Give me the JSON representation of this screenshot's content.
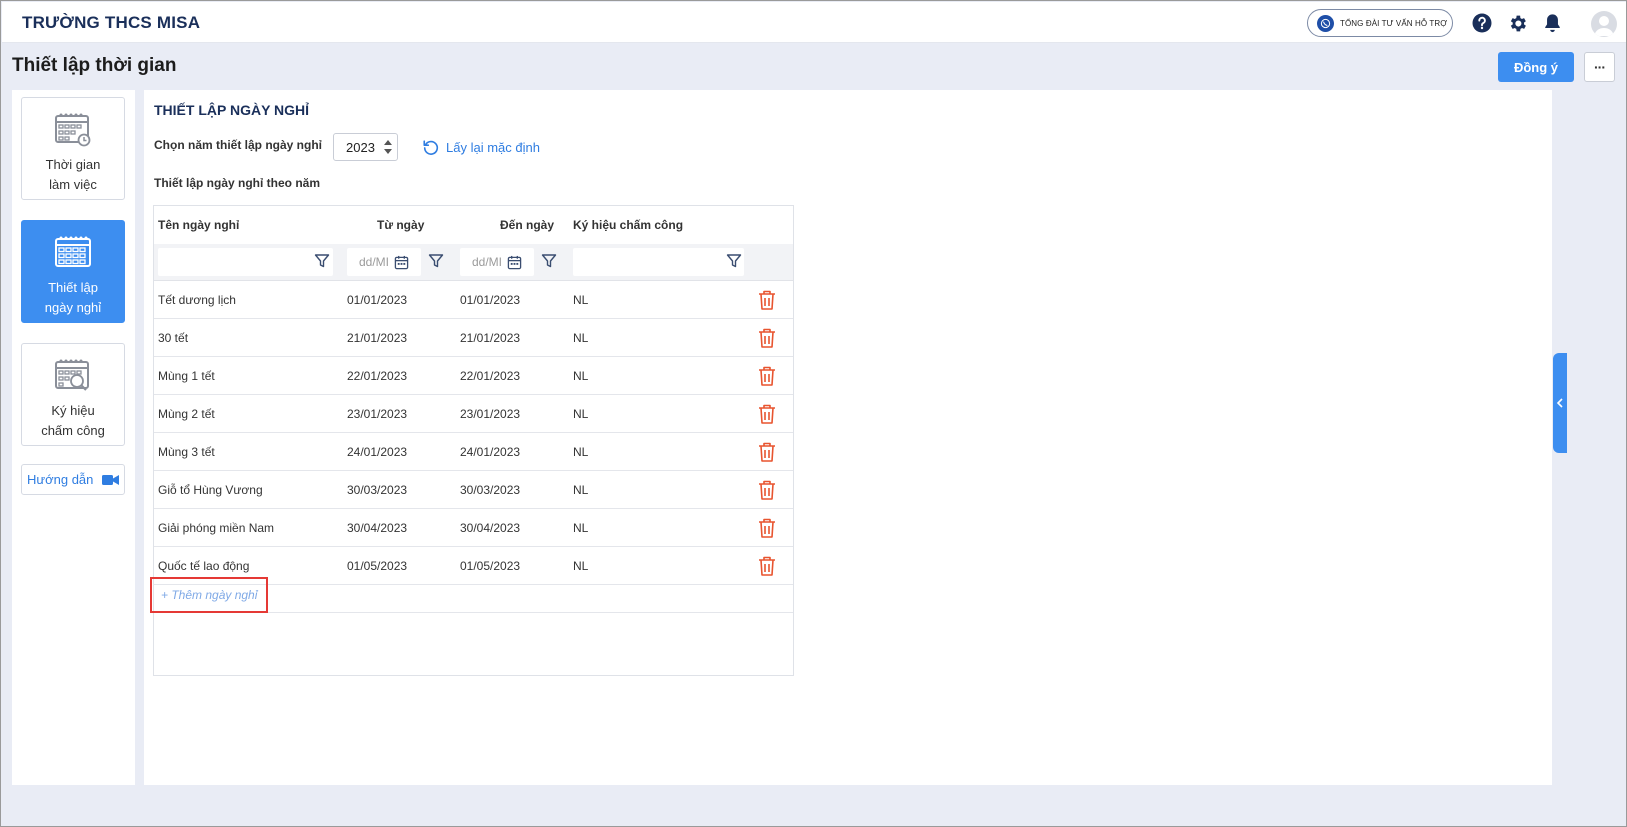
{
  "app": {
    "title": "TRƯỜNG THCS MISA"
  },
  "header": {
    "hotline_label": "TỔNG ĐÀI TƯ VẤN HỖ TRỢ",
    "icons": [
      "help-icon",
      "settings-icon",
      "bell-icon",
      "avatar"
    ]
  },
  "page": {
    "title": "Thiết lập thời gian",
    "agree_label": "Đồng ý",
    "more_label": "···"
  },
  "nav": {
    "items": [
      {
        "line1": "Thời gian",
        "line2": "làm việc",
        "active": false
      },
      {
        "line1": "Thiết lập",
        "line2": "ngày nghỉ",
        "active": true
      },
      {
        "line1": "Ký hiệu",
        "line2": "chấm công",
        "active": false
      }
    ],
    "guide_label": "Hướng dẫn"
  },
  "main": {
    "section_title": "THIẾT LẬP NGÀY NGHỈ",
    "year_label": "Chọn năm thiết lập ngày nghỉ",
    "year_value": "2023",
    "reset_label": "Lấy lại mặc định",
    "sub_title": "Thiết lập ngày nghỉ theo năm",
    "table": {
      "columns": [
        "Tên ngày nghỉ",
        "Từ ngày",
        "Đến ngày",
        "Ký hiệu chấm công"
      ],
      "date_placeholder": "dd/MI",
      "rows": [
        [
          "Tết dương lịch",
          "01/01/2023",
          "01/01/2023",
          "NL"
        ],
        [
          "30 tết",
          "21/01/2023",
          "21/01/2023",
          "NL"
        ],
        [
          "Mùng 1 tết",
          "22/01/2023",
          "22/01/2023",
          "NL"
        ],
        [
          "Mùng 2 tết",
          "23/01/2023",
          "23/01/2023",
          "NL"
        ],
        [
          "Mùng 3 tết",
          "24/01/2023",
          "24/01/2023",
          "NL"
        ],
        [
          "Giỗ tổ Hùng Vương",
          "30/03/2023",
          "30/03/2023",
          "NL"
        ],
        [
          "Giải phóng miền Nam",
          "30/04/2023",
          "30/04/2023",
          "NL"
        ],
        [
          "Quốc tế lao động",
          "01/05/2023",
          "01/05/2023",
          "NL"
        ]
      ],
      "add_label": "+ Thêm ngày nghỉ"
    }
  },
  "colors": {
    "primary": "#3d8ef0",
    "title_navy": "#1a2f5a",
    "delete_red": "#e8542f",
    "highlight_red": "#e53935"
  }
}
